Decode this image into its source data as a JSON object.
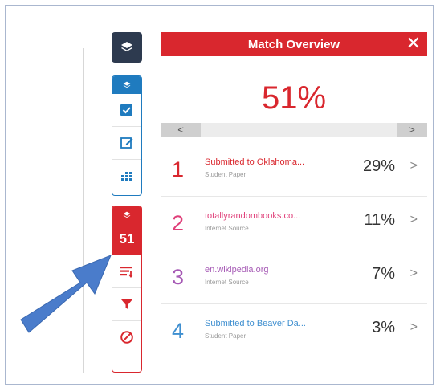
{
  "panel": {
    "title": "Match Overview",
    "close": "✕",
    "overall_similarity": "51%"
  },
  "scroller": {
    "left": "<",
    "right": ">"
  },
  "sidebar": {
    "match_count": "51"
  },
  "matches": [
    {
      "num": "1",
      "title": "Submitted to Oklahoma...",
      "type": "Student Paper",
      "pct": "29%",
      "color": "#d9272e"
    },
    {
      "num": "2",
      "title": "totallyrandombooks.co...",
      "type": "Internet Source",
      "pct": "11%",
      "color": "#e0407a"
    },
    {
      "num": "3",
      "title": "en.wikipedia.org",
      "type": "Internet Source",
      "pct": "7%",
      "color": "#a65ab5"
    },
    {
      "num": "4",
      "title": "Submitted to Beaver Da...",
      "type": "Student Paper",
      "pct": "3%",
      "color": "#3f8fd0"
    }
  ],
  "colors": {
    "accent_red": "#d9272e",
    "accent_blue": "#1f7bbf",
    "dark_slate": "#2d3a4f",
    "arrow_blue": "#4a7ccb"
  }
}
